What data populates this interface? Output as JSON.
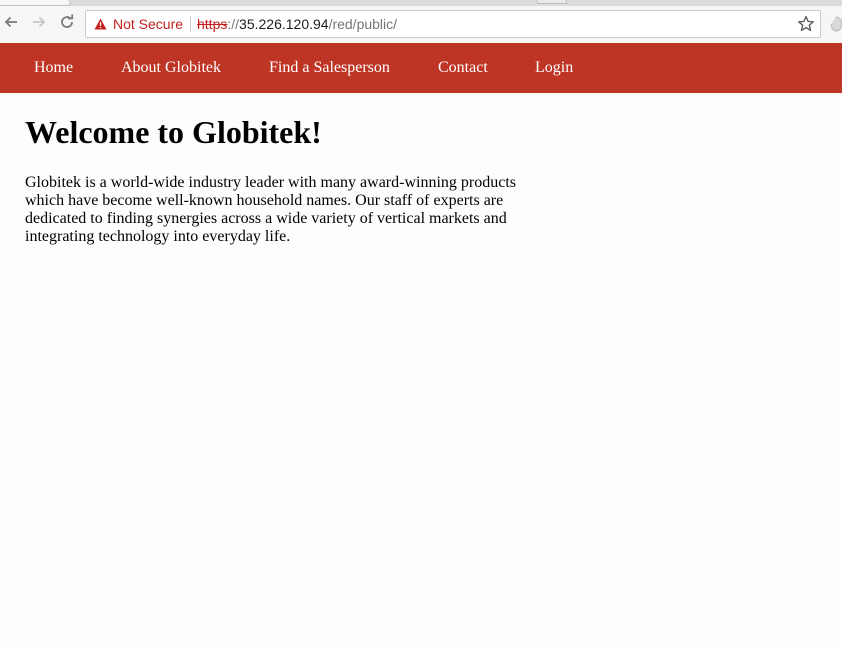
{
  "browser": {
    "security_label": "Not Secure",
    "url": {
      "scheme": "https",
      "separator": "://",
      "host": "35.226.120.94",
      "path": "/red/public/"
    },
    "icons": {
      "back": "arrow-left-icon",
      "forward": "arrow-right-icon",
      "reload": "reload-icon",
      "security": "warning-triangle-icon",
      "bookmark": "star-icon",
      "extension": "extension-icon"
    },
    "colors": {
      "warning": "#c5221f"
    }
  },
  "site_nav": {
    "background_color": "#be3425",
    "items": [
      {
        "label": "Home"
      },
      {
        "label": "About Globitek"
      },
      {
        "label": "Find a Salesperson"
      },
      {
        "label": "Contact"
      },
      {
        "label": "Login"
      }
    ]
  },
  "main": {
    "heading": "Welcome to Globitek!",
    "body": "Globitek is a world-wide industry leader with many award-winning products which have become well-known household names. Our staff of experts are dedicated to finding synergies across a wide variety of vertical markets and integrating technology into everyday life."
  }
}
